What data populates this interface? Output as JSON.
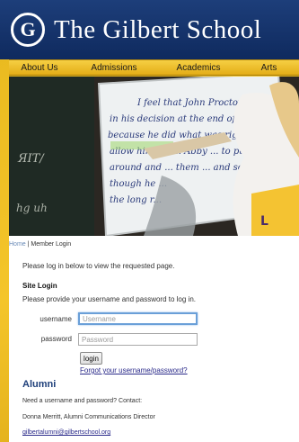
{
  "header": {
    "seal_letter": "G",
    "school_name": "The Gilbert School"
  },
  "nav": {
    "items": [
      "About Us",
      "Admissions",
      "Academics",
      "Arts"
    ]
  },
  "hero": {
    "board_lines": [
      "I feel that John Proctor was justified",
      "in his decision at the end of the play",
      "because he did what was right. He wouldn't",
      "allow himself ... Abby ... to push him",
      "around and ... them ... and so to help o",
      "though he ...",
      "the long r..."
    ]
  },
  "breadcrumb": {
    "home": "Home",
    "separator": " | ",
    "current": "Member Login"
  },
  "login": {
    "intro": "Please log in below to view the requested page.",
    "heading": "Site Login",
    "instructions": "Please provide your username and password to log in.",
    "username_label": "username",
    "username_placeholder": "Username",
    "password_label": "password",
    "password_placeholder": "Password",
    "button_label": "login",
    "forgot_link": "Forgot your username/password?"
  },
  "alumni": {
    "heading": "Alumni",
    "need_text": "Need a username and password?  Contact:",
    "contact_name": "Donna Merritt, Alumni Communications Director",
    "email": "gilbertalumni@gilbertschool.org"
  },
  "colors": {
    "header_blue": "#163469",
    "nav_gold": "#eebd2b",
    "alumni_heading": "#1e3f7a",
    "link": "#2a2a8a"
  }
}
